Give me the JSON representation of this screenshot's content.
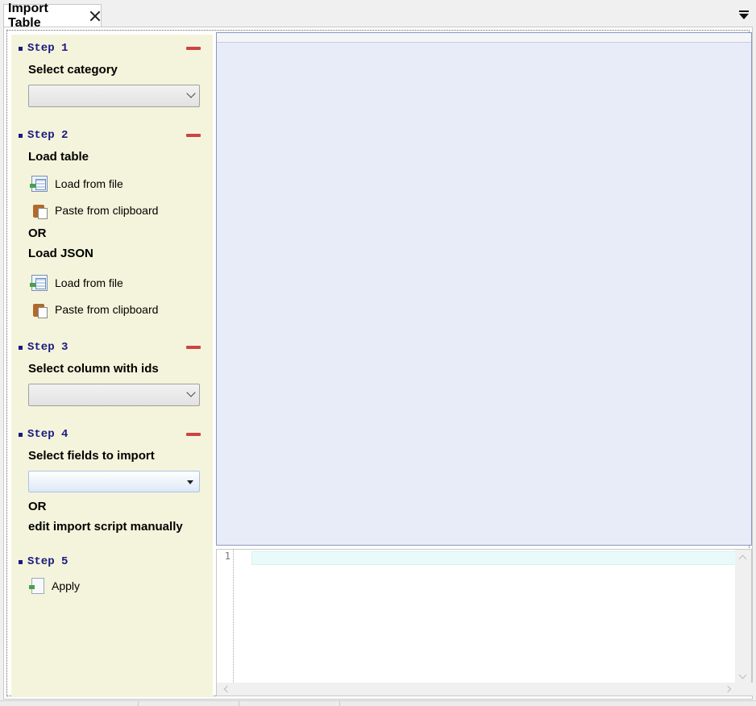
{
  "tab": {
    "title": "Import Table"
  },
  "steps": [
    {
      "title": "Step 1",
      "label": "Select category",
      "combo_value": ""
    },
    {
      "title": "Step 2",
      "label": "Load table",
      "actions": [
        "Load from file",
        "Paste from clipboard"
      ],
      "or": "OR",
      "label2": "Load JSON",
      "actions2": [
        "Load from file",
        "Paste from clipboard"
      ]
    },
    {
      "title": "Step 3",
      "label": "Select column with ids",
      "combo_value": ""
    },
    {
      "title": "Step 4",
      "label": "Select fields to import",
      "combo_value": "",
      "or": "OR",
      "label2": "edit import script manually"
    },
    {
      "title": "Step 5",
      "action": "Apply"
    }
  ],
  "editor": {
    "line_number": "1",
    "content": ""
  },
  "icons": {
    "tab_close": "close-icon",
    "tab_menu": "dropdown-menu-icon",
    "collapse": "minus-icon",
    "load_file": "table-file-icon",
    "paste": "clipboard-icon",
    "apply": "apply-document-icon"
  },
  "colors": {
    "steps_panel_bg": "#f4f4dc",
    "step_title": "#1a1a80",
    "collapse_bar": "#cc4444",
    "grid_bg": "#e8ecf9",
    "current_line": "#e8fbfa"
  }
}
